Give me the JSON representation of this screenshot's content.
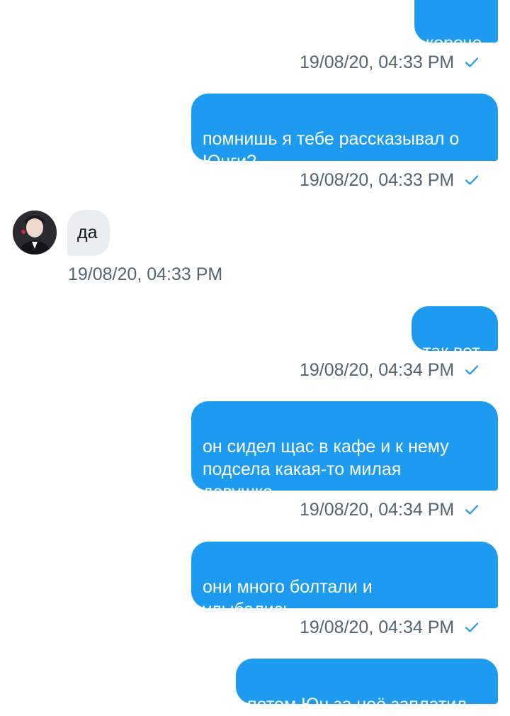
{
  "colors": {
    "outgoing_bubble": "#1d9bf0",
    "incoming_bubble": "#e9edf1",
    "meta_text": "#536471",
    "check": "#1d9bf0"
  },
  "messages": [
    {
      "direction": "outgoing",
      "text": "короче",
      "time": "19/08/20, 04:33 PM",
      "status_icon": "check-icon"
    },
    {
      "direction": "outgoing",
      "text": "помнишь я тебе рассказывал о\nЮнги?",
      "time": "19/08/20, 04:33 PM",
      "status_icon": "check-icon"
    },
    {
      "direction": "incoming",
      "text": "да",
      "time": "19/08/20, 04:33 PM"
    },
    {
      "direction": "outgoing",
      "text": "так вот",
      "time": "19/08/20, 04:34 PM",
      "status_icon": "check-icon"
    },
    {
      "direction": "outgoing",
      "text": "он сидел щас в кафе и к нему\nподсела какая-то милая\nдевушка",
      "time": "19/08/20, 04:34 PM",
      "status_icon": "check-icon"
    },
    {
      "direction": "outgoing",
      "text": "они много болтали и\nулыбались",
      "time": "19/08/20, 04:34 PM",
      "status_icon": "check-icon"
    },
    {
      "direction": "outgoing",
      "text": "потом Юн за неё заплатил"
    }
  ]
}
